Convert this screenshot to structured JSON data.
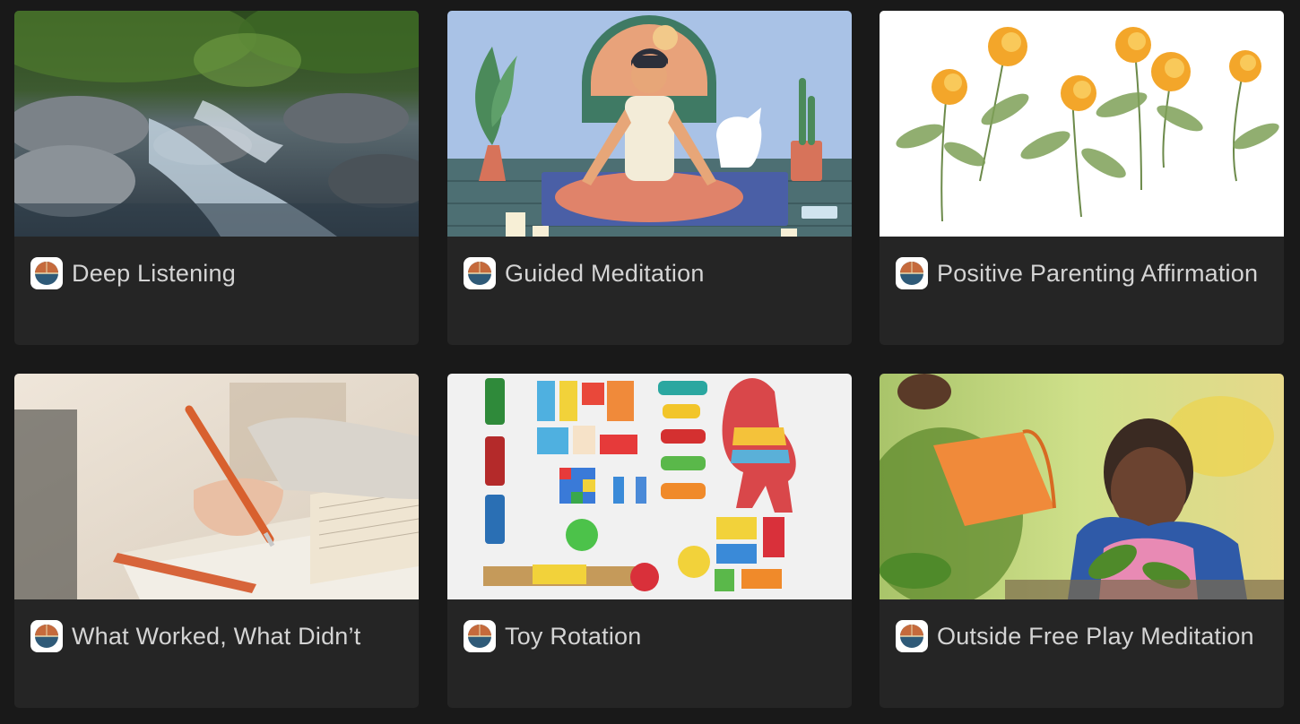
{
  "cards": [
    {
      "title": "Deep Listening",
      "cover": "forest-stream-photo",
      "icon": "logo-icon"
    },
    {
      "title": "Guided Meditation",
      "cover": "meditation-illustration",
      "icon": "logo-icon"
    },
    {
      "title": "Positive Parenting Affirmation",
      "cover": "orange-poppies-illustration",
      "icon": "logo-icon"
    },
    {
      "title": "What Worked, What Didn’t",
      "cover": "writing-in-journal-photo",
      "icon": "logo-icon"
    },
    {
      "title": "Toy Rotation",
      "cover": "toys-flatlay-photo",
      "icon": "logo-icon"
    },
    {
      "title": "Outside Free Play Meditation",
      "cover": "child-watering-plants-photo",
      "icon": "logo-icon"
    }
  ],
  "colors": {
    "background": "#191919",
    "card": "#252525",
    "title_text": "#d4d4d4",
    "logo_top": "#c56a3c",
    "logo_bottom": "#2f5a78"
  }
}
